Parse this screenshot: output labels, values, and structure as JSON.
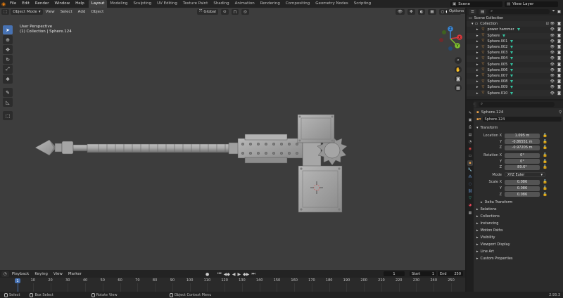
{
  "menu": {
    "items": [
      "File",
      "Edit",
      "Render",
      "Window",
      "Help"
    ]
  },
  "workspaces": [
    "Layout",
    "Modeling",
    "Sculpting",
    "UV Editing",
    "Texture Paint",
    "Shading",
    "Animation",
    "Rendering",
    "Compositing",
    "Geometry Nodes",
    "Scripting"
  ],
  "active_workspace": "Layout",
  "scene": {
    "label": "Scene",
    "view_layer": "View Layer"
  },
  "viewport": {
    "mode": "Object Mode",
    "menus": [
      "View",
      "Select",
      "Add",
      "Object"
    ],
    "orientation": "Global",
    "options_label": "Options",
    "info_line1": "User Perspective",
    "info_line2": "(1) Collection | Sphere.124",
    "gizmo": {
      "x": "X",
      "y": "Y",
      "z": "Z",
      "colors": {
        "x": "#d9383c",
        "y": "#7ec22e",
        "z": "#3a86d4"
      }
    }
  },
  "timeline": {
    "menus": [
      "Playback",
      "Keying",
      "View",
      "Marker"
    ],
    "current_frame": "1",
    "start_label": "Start",
    "start": "1",
    "end_label": "End",
    "end": "250",
    "ticks": [
      "10",
      "20",
      "30",
      "40",
      "50",
      "60",
      "70",
      "80",
      "90",
      "100",
      "110",
      "120",
      "130",
      "140",
      "150",
      "160",
      "170",
      "180",
      "190",
      "200",
      "210",
      "220",
      "230",
      "240",
      "250"
    ],
    "playhead_label": "1"
  },
  "statusbar": {
    "select": "Select",
    "box_select": "Box Select",
    "rotate": "Rotate View",
    "context": "Object Context Menu",
    "version": "2.93.3"
  },
  "outliner": {
    "root": "Scene Collection",
    "collection": "Collection",
    "items": [
      "power hammer",
      "Sphere",
      "Sphere.001",
      "Sphere.002",
      "Sphere.003",
      "Sphere.004",
      "Sphere.005",
      "Sphere.006",
      "Sphere.007",
      "Sphere.008",
      "Sphere.009",
      "Sphere.010"
    ]
  },
  "properties": {
    "object_name": "Sphere.124",
    "data_name": "Sphere.124",
    "transform_label": "Transform",
    "location": {
      "label": "Location X",
      "x": "1.095 m",
      "y_label": "Y",
      "y": "-0.86551 m",
      "z_label": "Z",
      "z": "-0.97205 m"
    },
    "rotation": {
      "label": "Rotation X",
      "x": "0°",
      "y_label": "Y",
      "y": "0°",
      "z_label": "Z",
      "z": "89.6°"
    },
    "mode_label": "Mode",
    "mode_value": "XYZ Euler",
    "scale": {
      "label": "Scale X",
      "x": "0.086",
      "y_label": "Y",
      "y": "0.086",
      "z_label": "Z",
      "z": "0.086"
    },
    "delta_transform": "Delta Transform",
    "panels": [
      "Relations",
      "Collections",
      "Instancing",
      "Motion Paths",
      "Visibility",
      "Viewport Display",
      "Line Art",
      "Custom Properties"
    ]
  }
}
